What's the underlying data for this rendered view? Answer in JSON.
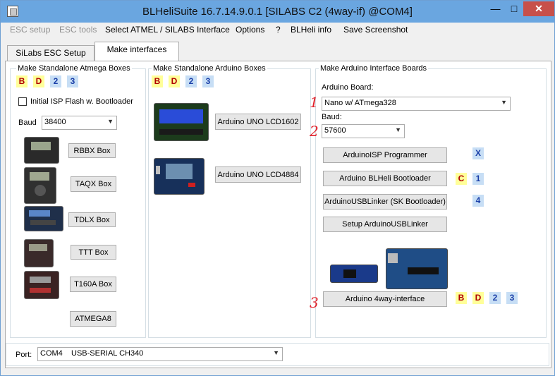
{
  "window": {
    "title": "BLHeliSuite 16.7.14.9.0.1  [SILABS C2 (4way-if) @COM4]",
    "controls": {
      "minimize": "—",
      "maximize": "□",
      "close": "✕"
    }
  },
  "menu": {
    "items": [
      {
        "label": "ESC setup",
        "enabled": false
      },
      {
        "label": "ESC tools",
        "enabled": false
      },
      {
        "label": "Select ATMEL / SILABS Interface",
        "enabled": true
      },
      {
        "label": "Options",
        "enabled": true
      },
      {
        "label": "?",
        "enabled": true
      },
      {
        "label": "BLHeli info",
        "enabled": true
      },
      {
        "label": "Save Screenshot",
        "enabled": true
      }
    ]
  },
  "tabs": [
    {
      "label": "SiLabs ESC Setup",
      "active": false
    },
    {
      "label": "Make interfaces",
      "active": true
    }
  ],
  "atmega_group": {
    "title": "Make Standalone Atmega Boxes",
    "badges": [
      "B",
      "D",
      "2",
      "3"
    ],
    "isp_flash_label": "Initial ISP Flash w. Bootloader",
    "baud_label": "Baud",
    "baud_value": "38400",
    "boxes": [
      {
        "label": "RBBX Box"
      },
      {
        "label": "TAQX Box"
      },
      {
        "label": "TDLX Box"
      },
      {
        "label": "TTT Box"
      },
      {
        "label": "T160A Box"
      },
      {
        "label": "ATMEGA8"
      }
    ]
  },
  "arduino_boxes_group": {
    "title": "Make Standalone Arduino Boxes",
    "badges": [
      "B",
      "D",
      "2",
      "3"
    ],
    "buttons": [
      {
        "label": "Arduino UNO LCD1602"
      },
      {
        "label": "Arduino UNO LCD4884"
      }
    ]
  },
  "interface_boards_group": {
    "title": "Make Arduino Interface Boards",
    "board_label": "Arduino Board:",
    "board_value": "Nano w/ ATmega328",
    "baud_label": "Baud:",
    "baud_value": "57600",
    "buttons": [
      {
        "label": "ArduinoISP Programmer",
        "badges": [
          "X"
        ]
      },
      {
        "label": "Arduino BLHeli Bootloader",
        "badges": [
          "C",
          "1"
        ]
      },
      {
        "label": "ArduinoUSBLinker (SK Bootloader)",
        "badges": [
          "4"
        ]
      },
      {
        "label": "Setup ArduinoUSBLinker",
        "badges": []
      }
    ],
    "fourway_label": "Arduino 4way-interface",
    "fourway_badges": [
      "B",
      "D",
      "2",
      "3"
    ]
  },
  "annotations": [
    "1",
    "2",
    "3"
  ],
  "port": {
    "label": "Port:",
    "value": "COM4    USB-SERIAL CH340"
  },
  "colors": {
    "titlebar": "#6aa6e0",
    "close": "#c7504a",
    "badge_yellow": "#ffff99",
    "badge_blue": "#c7def5",
    "annotation_red": "#e0202a"
  },
  "icons": [
    "app-icon",
    "chevron-down-icon",
    "checkbox-icon"
  ]
}
